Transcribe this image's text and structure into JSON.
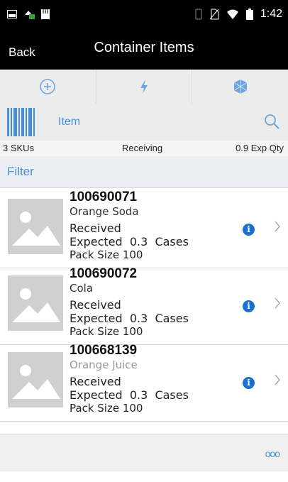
{
  "status_bar": {
    "time": "1:42",
    "icons": [
      "image-notification-icon",
      "android-icon",
      "storage-icon",
      "vibrate-icon",
      "no-sim-icon",
      "wifi-icon",
      "battery-icon"
    ]
  },
  "header": {
    "back_label": "Back",
    "title": "Container Items"
  },
  "toolbar": {
    "buttons": [
      "add-icon",
      "lightning-icon",
      "cube-icon"
    ]
  },
  "search": {
    "placeholder": "Item",
    "value": ""
  },
  "summary": {
    "skus": "3 SKUs",
    "mode": "Receiving",
    "exp_qty": "0.9 Exp Qty"
  },
  "filter_label": "Filter",
  "items": [
    {
      "code": "100690071",
      "name": "Orange Soda",
      "status": "Received",
      "expected": "Expected  0.3  Cases",
      "pack": "Pack Size 100"
    },
    {
      "code": "100690072",
      "name": "Cola",
      "status": "Received",
      "expected": "Expected  0.3  Cases",
      "pack": "Pack Size 100"
    },
    {
      "code": "100668139",
      "name": "Orange Juice",
      "status": "Received",
      "expected": "Expected  0.3  Cases",
      "pack": "Pack Size 100"
    }
  ],
  "footer": {
    "more_label": "ooo"
  },
  "colors": {
    "accent": "#4a90d9",
    "info": "#1a6fd1",
    "header_bg": "#000000"
  }
}
